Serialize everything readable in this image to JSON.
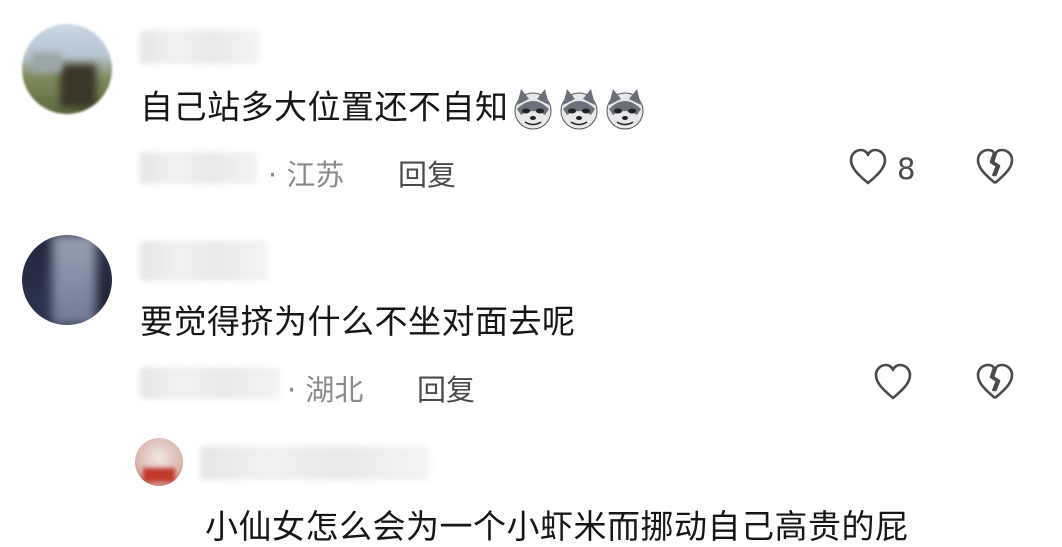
{
  "comments": [
    {
      "text": "自己站多大位置还不自知",
      "emoji_names": [
        "husky-doge-emoji",
        "husky-doge-emoji",
        "husky-doge-emoji"
      ],
      "location": "· 江苏",
      "reply_label": "回复",
      "like_count": "8"
    },
    {
      "text": "要觉得挤为什么不坐对面去呢",
      "location": "· 湖北",
      "reply_label": "回复",
      "like_count": ""
    },
    {
      "text": "小仙女怎么会为一个小虾米而挪动自己高贵的屁"
    }
  ],
  "icons": {
    "like": "heart-outline-icon",
    "dislike": "broken-heart-icon"
  },
  "colors": {
    "text": "#161616",
    "meta": "#8a8a8a",
    "icon": "#4a4a4a"
  }
}
